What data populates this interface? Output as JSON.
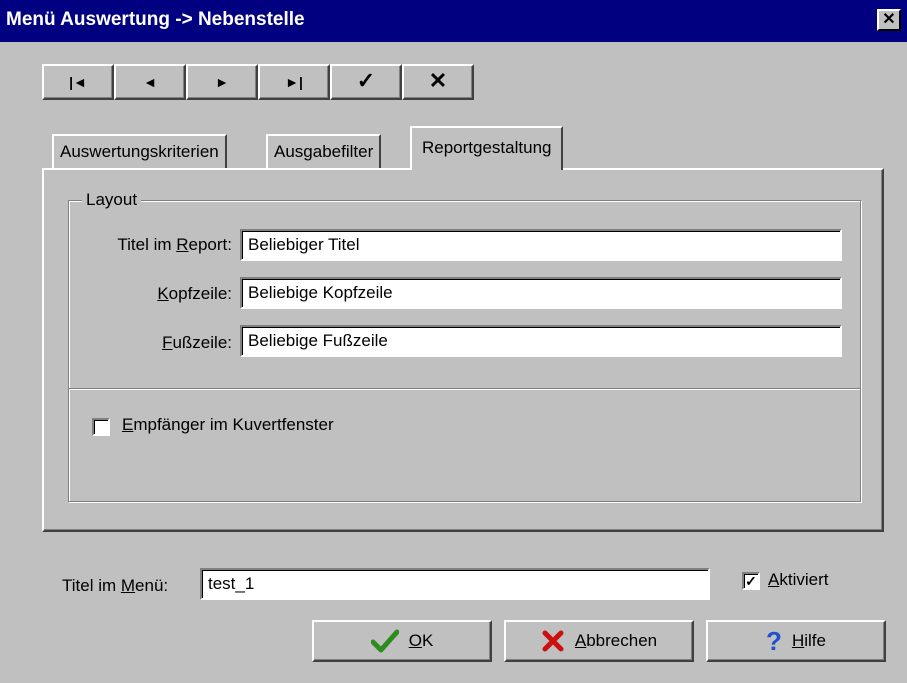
{
  "window": {
    "title": "Menü Auswertung -> Nebenstelle",
    "close_glyph": "✕"
  },
  "nav": {
    "first": "|◄",
    "prev": "◄",
    "next": "►",
    "last": "►|",
    "confirm": "✓",
    "cancel": "✕"
  },
  "tabs": [
    {
      "label": "Auswertungskriterien",
      "active": false
    },
    {
      "label": "Ausgabefilter",
      "active": false
    },
    {
      "label": "Reportgestaltung",
      "active": true
    }
  ],
  "layout": {
    "legend": "Layout",
    "titel_label_pre": "Titel im ",
    "titel_label_u": "R",
    "titel_label_post": "eport:",
    "titel_value": "Beliebiger Titel",
    "kopf_label_u": "K",
    "kopf_label_post": "opfzeile:",
    "kopf_value": "Beliebige Kopfzeile",
    "fuss_label_u": "F",
    "fuss_label_post": "ußzeile:",
    "fuss_value": "Beliebige Fußzeile",
    "empf_u": "E",
    "empf_label": "mpfänger im Kuvertfenster",
    "empf_checked": false
  },
  "menu_title": {
    "label_pre": "Titel im ",
    "label_u": "M",
    "label_post": "enü:",
    "value": "test_1"
  },
  "aktiviert": {
    "u": "A",
    "label": "ktiviert",
    "checked": true
  },
  "buttons": {
    "ok_u": "O",
    "ok_post": "K",
    "abbrechen_u": "A",
    "abbrechen_post": "bbrechen",
    "hilfe_u": "H",
    "hilfe_post": "ilfe"
  },
  "colors": {
    "titlebar": "#000080",
    "face": "#c0c0c0",
    "ok_icon": "#2e8b1e",
    "cancel_icon": "#cc1010",
    "help_icon": "#1e50d0"
  }
}
